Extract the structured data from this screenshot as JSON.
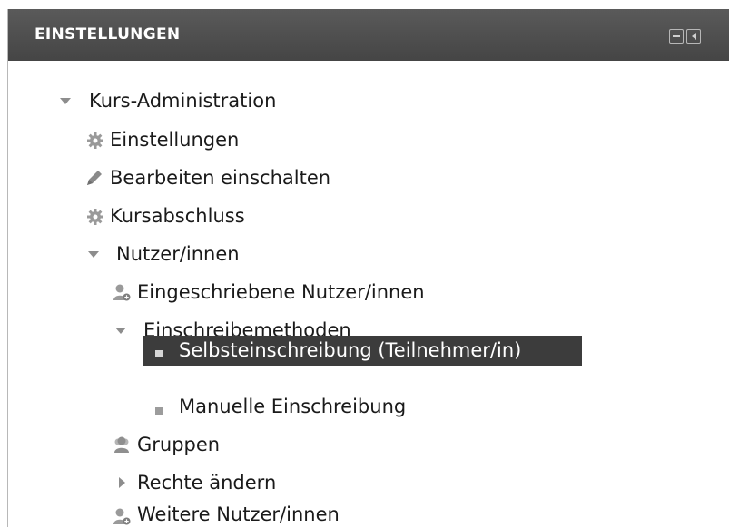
{
  "header": {
    "title": "EINSTELLUNGEN"
  },
  "tree": {
    "kurs_admin": "Kurs-Administration",
    "einstellungen": "Einstellungen",
    "bearbeiten": "Bearbeiten einschalten",
    "kursabschluss": "Kursabschluss",
    "nutzer": "Nutzer/innen",
    "eingeschriebene": "Eingeschriebene Nutzer/innen",
    "einschreibemethoden": "Einschreibemethoden",
    "selbsteinschreibung": "Selbsteinschreibung (Teilnehmer/in)",
    "manuelle": "Manuelle Einschreibung",
    "gruppen": "Gruppen",
    "rechte": "Rechte ändern",
    "weitere": "Weitere Nutzer/innen"
  },
  "colors": {
    "header_bg": "#4f4f4f",
    "selection_bg": "#3c3c3c",
    "icon_gray": "#8d8d8d"
  },
  "icons": [
    "gear-icon",
    "pencil-icon",
    "user-add-icon",
    "group-icon",
    "collapse-icon",
    "dock-icon"
  ]
}
